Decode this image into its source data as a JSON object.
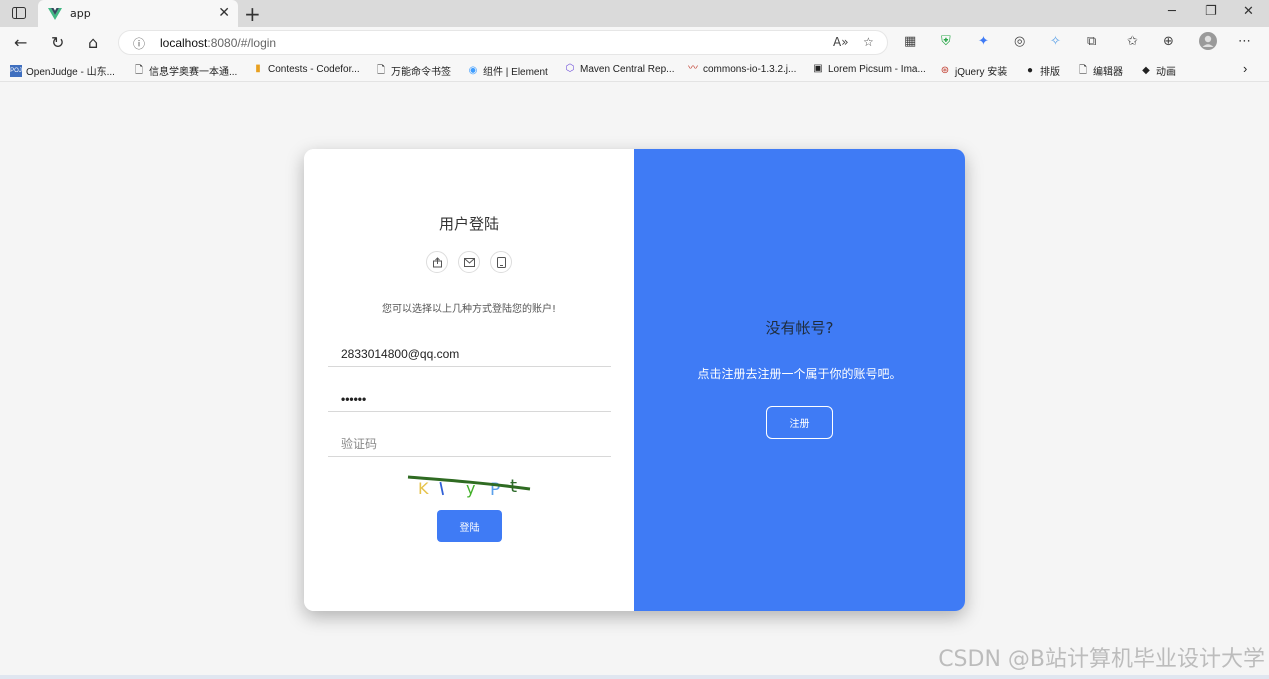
{
  "browser": {
    "tab_title": "app",
    "tab_close": "✕",
    "new_tab": "+",
    "url_host": "localhost",
    "url_rest": ":8080/#/login",
    "window_controls": [
      "─",
      "❐",
      "✕"
    ]
  },
  "bookmarks": [
    {
      "label": "OpenJudge - 山东...",
      "icon": "POJ"
    },
    {
      "label": "信息学奥赛一本通...",
      "icon": "page"
    },
    {
      "label": "Contests - Codefor...",
      "icon": "bars"
    },
    {
      "label": "万能命令书签",
      "icon": "page"
    },
    {
      "label": "组件 | Element",
      "icon": "element"
    },
    {
      "label": "Maven Central Rep...",
      "icon": "hex"
    },
    {
      "label": "commons-io-1.3.2.j...",
      "icon": "feather"
    },
    {
      "label": "Lorem Picsum - Ima...",
      "icon": "image"
    },
    {
      "label": "jQuery 安装",
      "icon": "jq"
    },
    {
      "label": "排版",
      "icon": "github"
    },
    {
      "label": "编辑器",
      "icon": "page"
    },
    {
      "label": "动画",
      "icon": "diamond"
    }
  ],
  "login": {
    "title": "用户登陆",
    "subtitle": "您可以选择以上几种方式登陆您的账户!",
    "email_value": "2833014800@qq.com",
    "password_value": "••••••",
    "captcha_placeholder": "验证码",
    "captcha_chars": [
      "K",
      "I",
      "y",
      "P",
      "t"
    ],
    "button": "登陆"
  },
  "register": {
    "title": "没有帐号?",
    "subtitle": "点击注册去注册一个属于你的账号吧。",
    "button": "注册"
  },
  "watermark": "CSDN @B站计算机毕业设计大学",
  "colors": {
    "primary": "#3f7bf5",
    "tab_strip": "#dadada"
  }
}
